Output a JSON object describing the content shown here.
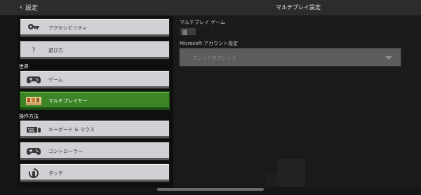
{
  "header": {
    "back_label": "設定",
    "title": "マルチプレイ設定"
  },
  "sidebar": {
    "items": [
      {
        "label": "アクセシビリティ",
        "icon": "key-icon"
      },
      {
        "label": "遊び方",
        "icon": "question-icon"
      },
      {
        "label": "ゲーム",
        "icon": "controller-icon"
      },
      {
        "label": "マルチプレイヤー",
        "icon": "players-icon",
        "selected": true
      },
      {
        "label": "キーボード & マウス",
        "icon": "keyboard-icon"
      },
      {
        "label": "コントローラー",
        "icon": "controller-icon"
      },
      {
        "label": "タッチ",
        "icon": "touch-icon"
      }
    ],
    "sections": {
      "world": "世界",
      "controls": "操作方法"
    }
  },
  "main": {
    "multiplayer_game_label": "マルチプレイ ゲーム",
    "multiplayer_game_enabled": false,
    "account_settings_label": "Microsoft アカウント設定",
    "friends_dropdown_value": "フレンドのフレンド"
  },
  "colors": {
    "accent_selected": "#3c8527",
    "button": "#d0d1d4",
    "background": "#161616"
  }
}
